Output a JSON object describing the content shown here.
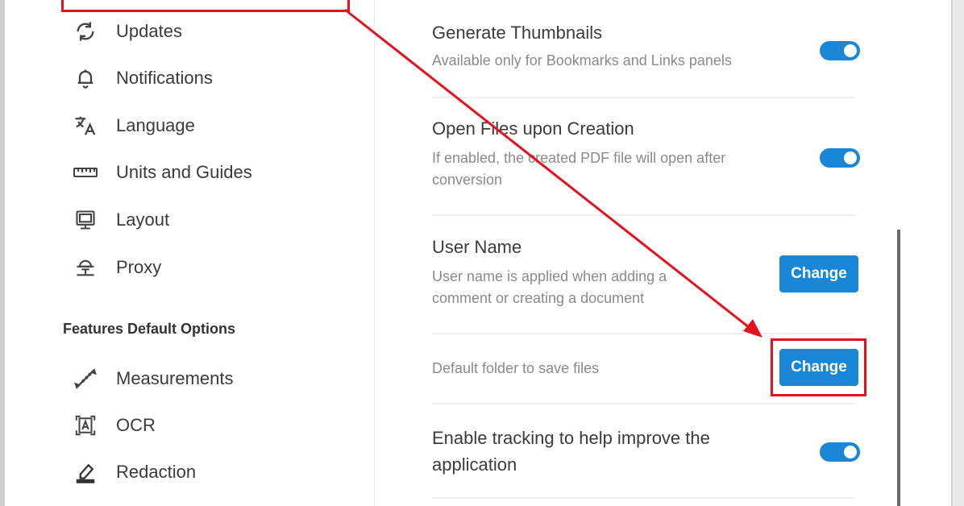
{
  "sidebar": {
    "items": [
      {
        "label": "Updates",
        "icon": "refresh-icon"
      },
      {
        "label": "Notifications",
        "icon": "bell-icon"
      },
      {
        "label": "Language",
        "icon": "translate-icon"
      },
      {
        "label": "Units and Guides",
        "icon": "ruler-icon"
      },
      {
        "label": "Layout",
        "icon": "layout-icon"
      },
      {
        "label": "Proxy",
        "icon": "proxy-icon"
      }
    ],
    "features_heading": "Features Default Options",
    "features": [
      {
        "label": "Measurements",
        "icon": "measure-icon"
      },
      {
        "label": "OCR",
        "icon": "ocr-icon"
      },
      {
        "label": "Redaction",
        "icon": "redaction-icon"
      }
    ]
  },
  "settings": {
    "thumbnails": {
      "title": "Generate Thumbnails",
      "desc": "Available only for Bookmarks and Links panels",
      "enabled": true
    },
    "open_files": {
      "title": "Open Files upon Creation",
      "desc_line1": "If enabled, the created PDF file will open after",
      "desc_line2": "conversion",
      "enabled": true
    },
    "user_name": {
      "title": "User Name",
      "desc_line1": "User name is applied when adding a",
      "desc_line2": "comment or creating a document",
      "button": "Change"
    },
    "default_folder": {
      "desc": "Default folder to save files",
      "button": "Change"
    },
    "tracking": {
      "title_line1": "Enable tracking to help improve the",
      "title_line2": "application",
      "enabled": true
    }
  },
  "colors": {
    "accent": "#1a86d8",
    "highlight": "#e3121c"
  }
}
